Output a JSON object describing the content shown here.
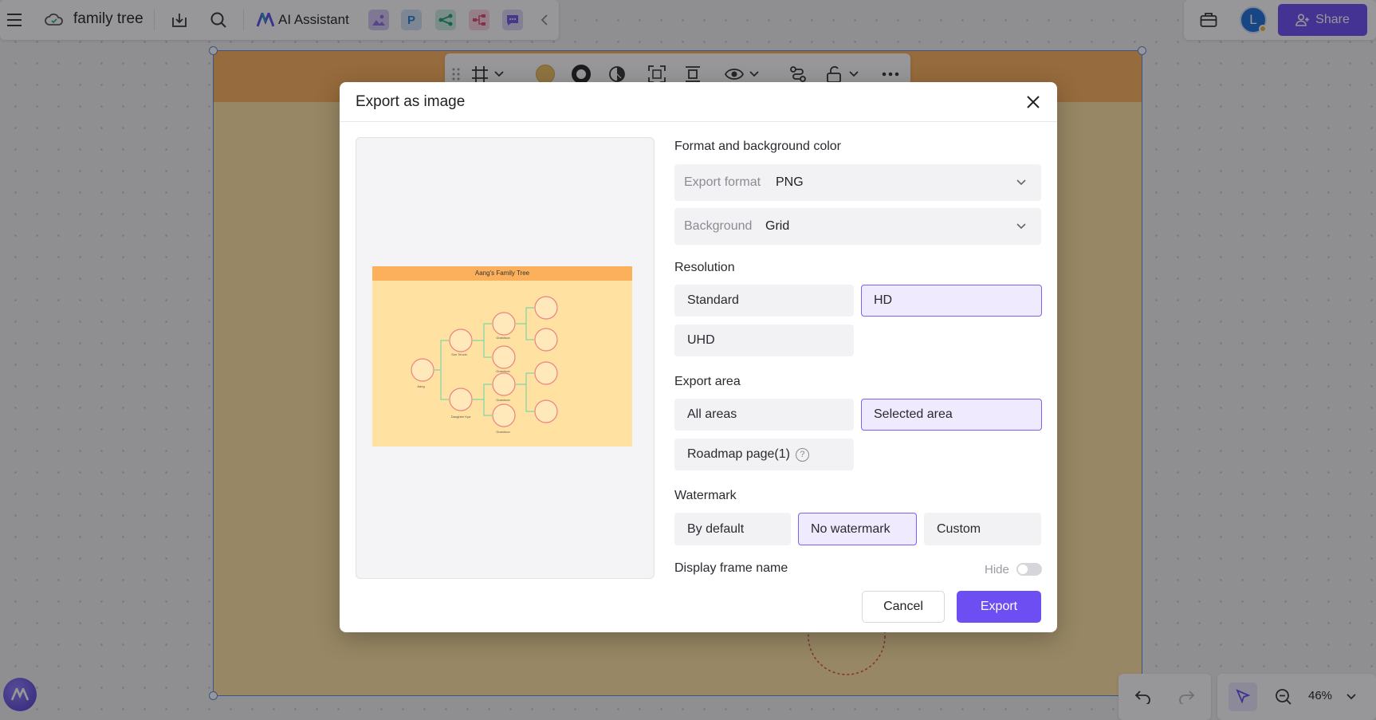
{
  "topbar": {
    "doc_title": "family tree",
    "ai_label": "AI Assistant",
    "share_label": "Share",
    "avatar_letter": "L",
    "icons": [
      "menu-icon",
      "cloud-icon",
      "download-icon",
      "search-icon",
      "ai-logo-icon",
      "image-app-icon",
      "p-app-icon",
      "share-app-icon",
      "mindmap-app-icon",
      "chat-app-icon",
      "collapse-chevron-icon",
      "toolbox-icon",
      "user-add-icon"
    ]
  },
  "floating_toolbar": {
    "icons": [
      "drag-handle-icon",
      "frame-icon",
      "chevron-down-icon",
      "fill-color-icon",
      "border-icon",
      "opacity-icon",
      "fit-icon",
      "align-icon",
      "visibility-icon",
      "chevron-down-icon",
      "connector-icon",
      "lock-icon",
      "chevron-down-icon",
      "more-icon"
    ]
  },
  "bottom": {
    "zoom": "46%",
    "icons": [
      "undo-icon",
      "redo-icon",
      "select-cursor-icon",
      "zoom-out-icon",
      "chevron-down-icon"
    ]
  },
  "dialog": {
    "title": "Export as image",
    "preview_title": "Aang's Family Tree",
    "preview_labels": [
      "Aang",
      "Son Tenzin",
      "Daughter Kya",
      "Grandson",
      "Grandson",
      "Grandson",
      "Grandson"
    ],
    "section_format": "Format and background color",
    "export_format_label": "Export format",
    "export_format_value": "PNG",
    "background_label": "Background",
    "background_value": "Grid",
    "section_resolution": "Resolution",
    "resolution_options": [
      "Standard",
      "HD",
      "UHD"
    ],
    "resolution_selected": "HD",
    "section_area": "Export area",
    "area_options": [
      "All areas",
      "Selected area",
      "Roadmap page(1)"
    ],
    "area_selected": "Selected area",
    "section_watermark": "Watermark",
    "watermark_options": [
      "By default",
      "No watermark",
      "Custom"
    ],
    "watermark_selected": "No watermark",
    "display_frame_name_label": "Display frame name",
    "toggle_label": "Hide",
    "toggle_on": false,
    "cancel_label": "Cancel",
    "export_label": "Export"
  },
  "colors": {
    "accent": "#6c4ef2",
    "selected_bg": "#efeafe",
    "frame_header": "#fdb05c",
    "frame_body": "#ffe2a1"
  }
}
